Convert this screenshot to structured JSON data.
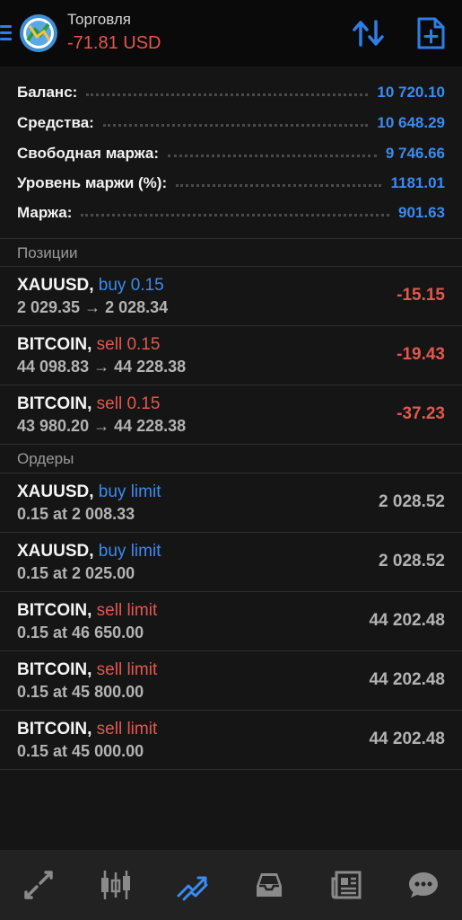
{
  "header": {
    "title": "Торговля",
    "profit": "-71.81 USD"
  },
  "summary": [
    {
      "label": "Баланс:",
      "value": "10 720.10"
    },
    {
      "label": "Средства:",
      "value": "10 648.29"
    },
    {
      "label": "Свободная маржа:",
      "value": "9 746.66"
    },
    {
      "label": "Уровень маржи (%):",
      "value": "1181.01"
    },
    {
      "label": "Маржа:",
      "value": "901.63"
    }
  ],
  "positions": {
    "title": "Позиции",
    "items": [
      {
        "symbol": "XAUUSD,",
        "side": "buy 0.15",
        "prices": "2 029.35 → 2 028.34",
        "profit": "-15.15"
      },
      {
        "symbol": "BITCOIN,",
        "side": "sell 0.15",
        "prices": "44 098.83 → 44 228.38",
        "profit": "-19.43"
      },
      {
        "symbol": "BITCOIN,",
        "side": "sell 0.15",
        "prices": "43 980.20 → 44 228.38",
        "profit": "-37.23"
      }
    ]
  },
  "orders": {
    "title": "Ордеры",
    "items": [
      {
        "symbol": "XAUUSD,",
        "side": "buy limit",
        "detail": "0.15 at 2 008.33",
        "price": "2 028.52"
      },
      {
        "symbol": "XAUUSD,",
        "side": "buy limit",
        "detail": "0.15 at 2 025.00",
        "price": "2 028.52"
      },
      {
        "symbol": "BITCOIN,",
        "side": "sell limit",
        "detail": "0.15 at 46 650.00",
        "price": "44 202.48"
      },
      {
        "symbol": "BITCOIN,",
        "side": "sell limit",
        "detail": "0.15 at 45 800.00",
        "price": "44 202.48"
      },
      {
        "symbol": "BITCOIN,",
        "side": "sell limit",
        "detail": "0.15 at 45 000.00",
        "price": "44 202.48"
      }
    ]
  },
  "nav": [
    {
      "icon": "quotes-icon"
    },
    {
      "icon": "chart-icon"
    },
    {
      "icon": "trade-icon",
      "active": true
    },
    {
      "icon": "history-icon"
    },
    {
      "icon": "news-icon"
    },
    {
      "icon": "chat-icon"
    }
  ],
  "colors": {
    "accent": "#3a8bf0",
    "loss": "#e4574f",
    "background": "#151515"
  }
}
